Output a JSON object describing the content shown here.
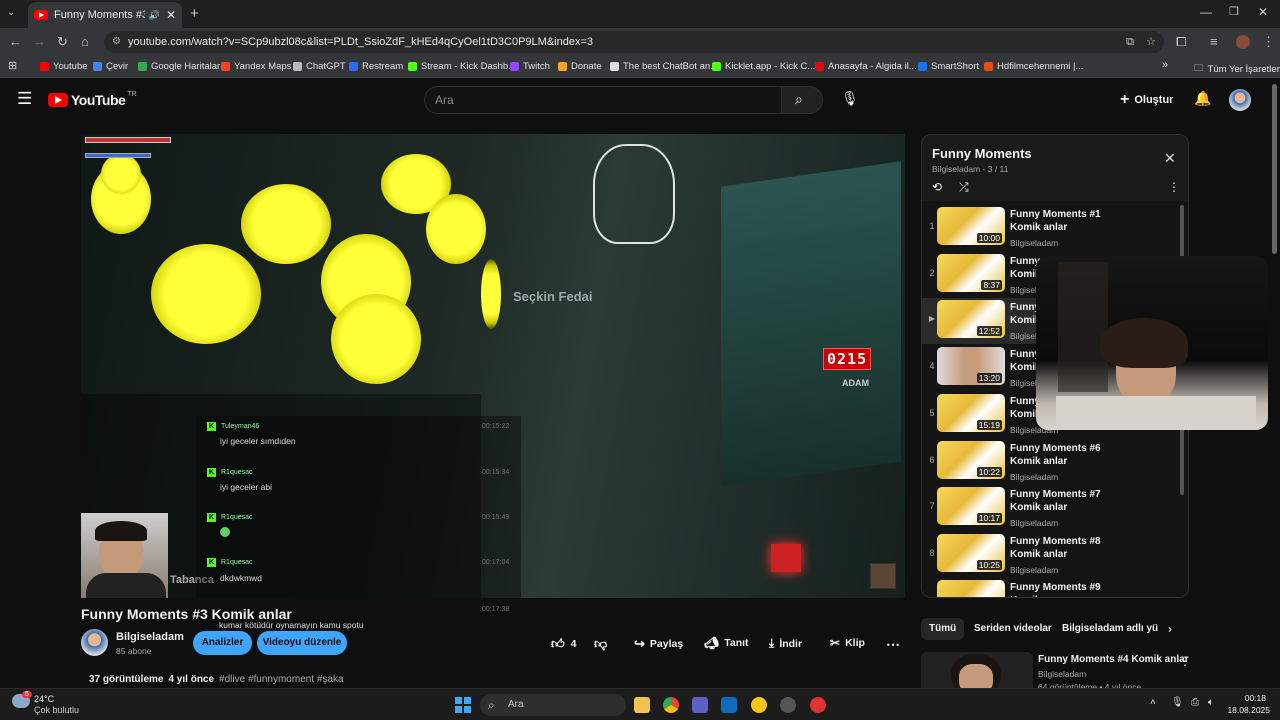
{
  "browser": {
    "tab_title": "Funny Moments #3 Komik a...",
    "url": "youtube.com/watch?v=SCp9ubzl08c&list=PLDt_SsioZdF_kHEd4qCyOel1tD3C0P9LM&index=3",
    "bookmarks": [
      {
        "label": "Youtube",
        "color": "#ff0000"
      },
      {
        "label": "Çevir",
        "color": "#4285f4"
      },
      {
        "label": "Google Haritalar",
        "color": "#34a853"
      },
      {
        "label": "Yandex Maps",
        "color": "#fc3f1d"
      },
      {
        "label": "ChatGPT",
        "color": "#bbbbbb"
      },
      {
        "label": "Restream",
        "color": "#2b6cff"
      },
      {
        "label": "Stream - Kick Dashb...",
        "color": "#53fc18"
      },
      {
        "label": "Twitch",
        "color": "#9146ff"
      },
      {
        "label": "Donate",
        "color": "#f5a623"
      },
      {
        "label": "The best ChatBot an...",
        "color": "#dddddd"
      },
      {
        "label": "Kicklet.app - Kick C...",
        "color": "#53fc18"
      },
      {
        "label": "Anasayfa - Algida il...",
        "color": "#e30613"
      },
      {
        "label": "SmartShort",
        "color": "#1a73e8"
      },
      {
        "label": "Hdfilmcehennemi |...",
        "color": "#e84a1a"
      }
    ],
    "all_bookmarks_label": "Tüm Yer İşaretleri"
  },
  "youtube": {
    "logo_text": "YouTube",
    "region": "TR",
    "search_placeholder": "Ara",
    "create_label": "Oluştur"
  },
  "video": {
    "title": "Funny Moments #3 Komik anlar",
    "game_text": {
      "npc_label": "Seçkin Fedai",
      "counter": "0215",
      "counter_label": "ADAM",
      "weapon_label": "Tabanca"
    },
    "chat": [
      {
        "user": "Tuleyman46",
        "msg": "iyi geceler sımdıden",
        "time": "00:15:22"
      },
      {
        "user": "R1quesac",
        "msg": "iyi geceler abi",
        "time": "00:15:34"
      },
      {
        "user": "R1quesac",
        "msg": "",
        "time": "00:15:49"
      },
      {
        "user": "R1quesac",
        "msg": "dkdwkmwd",
        "time": "00:17:04"
      },
      {
        "user": "",
        "msg": "kumar kötüdür oynamayın kamu spotu",
        "time": "00:17:38"
      }
    ]
  },
  "channel": {
    "name": "Bilgiseladam",
    "subs": "85 abone",
    "analytics_label": "Analizler",
    "edit_label": "Videoyu düzenle"
  },
  "actions": {
    "likes": "4",
    "share": "Paylaş",
    "promote": "Tanıt",
    "download": "İndir",
    "clip": "Klip"
  },
  "meta": {
    "views": "37 görüntüleme",
    "age": "4 yıl önce",
    "tags": "#dlive #funnymoment #şaka"
  },
  "playlist": {
    "title": "Funny Moments",
    "sub": "Bilgiseladam - 3 / 11",
    "items": [
      {
        "idx": "1",
        "title": "Funny Moments #1 Komik anlar",
        "channel": "Bilgiseladam",
        "duration": "10:00"
      },
      {
        "idx": "2",
        "title": "Funny Moments #2 Komik anlar",
        "channel": "Bilgiseladam",
        "duration": "8:37"
      },
      {
        "idx": "▶",
        "title": "Funny Moments #3 Komik anlar",
        "channel": "Bilgiseladam",
        "duration": "12:52"
      },
      {
        "idx": "4",
        "title": "Funny Moments #4 Komik anlar",
        "channel": "Bilgiseladam",
        "duration": "13:20"
      },
      {
        "idx": "5",
        "title": "Funny Moments #5 Komik anlar",
        "channel": "Bilgiseladam",
        "duration": "15:19"
      },
      {
        "idx": "6",
        "title": "Funny Moments #6 Komik anlar",
        "channel": "Bilgiseladam",
        "duration": "10:22"
      },
      {
        "idx": "7",
        "title": "Funny Moments #7 Komik anlar",
        "channel": "Bilgiseladam",
        "duration": "10:17"
      },
      {
        "idx": "8",
        "title": "Funny Moments #8 Komik anlar",
        "channel": "Bilgiseladam",
        "duration": "10:25"
      },
      {
        "idx": "",
        "title": "Funny Moments #9 Komik",
        "channel": "",
        "duration": ""
      }
    ]
  },
  "chips": [
    "Tümü",
    "Seriden videolar",
    "Bilgiseladam adlı yükl"
  ],
  "recommended": {
    "title": "Funny Moments #4 Komik anlar",
    "channel": "Bilgiseladam",
    "meta": "64 görüntüleme • 4 yıl önce"
  },
  "taskbar": {
    "weather_temp": "24°C",
    "weather_desc": "Çok bulutlu",
    "search_label": "Ara",
    "time": "00:18",
    "date": "18.08.2025",
    "notif_count": "5"
  }
}
